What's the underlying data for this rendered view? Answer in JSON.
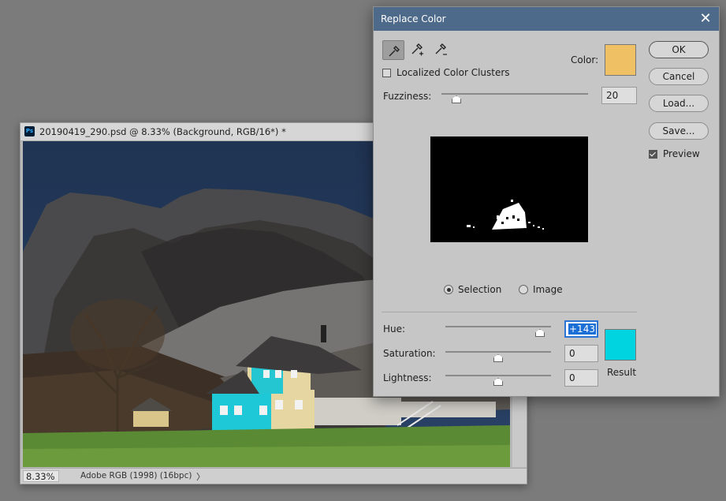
{
  "document": {
    "title": "20190419_290.psd @ 8.33% (Background, RGB/16*) *",
    "app_icon_text": "Ps",
    "zoom": "8.33%",
    "color_profile": "Adobe RGB (1998) (16bpc)",
    "status_arrow": "〉"
  },
  "dialog": {
    "title": "Replace Color",
    "close_icon": "✕",
    "tools": [
      "eyedropper-icon",
      "eyedropper-plus-icon",
      "eyedropper-minus-icon"
    ],
    "localized_label": "Localized Color Clusters",
    "localized_checked": false,
    "color_label": "Color:",
    "color_swatch": "#f0c164",
    "fuzziness_label": "Fuzziness:",
    "fuzziness_value": "20",
    "view_selection_label": "Selection",
    "view_image_label": "Image",
    "view_selected": "Selection",
    "hue_label": "Hue:",
    "hue_value": "+143",
    "saturation_label": "Saturation:",
    "saturation_value": "0",
    "lightness_label": "Lightness:",
    "lightness_value": "0",
    "result_label": "Result",
    "result_swatch": "#00d4e0",
    "buttons": {
      "ok": "OK",
      "cancel": "Cancel",
      "load": "Load...",
      "save": "Save..."
    },
    "preview_label": "Preview",
    "preview_checked": true
  }
}
